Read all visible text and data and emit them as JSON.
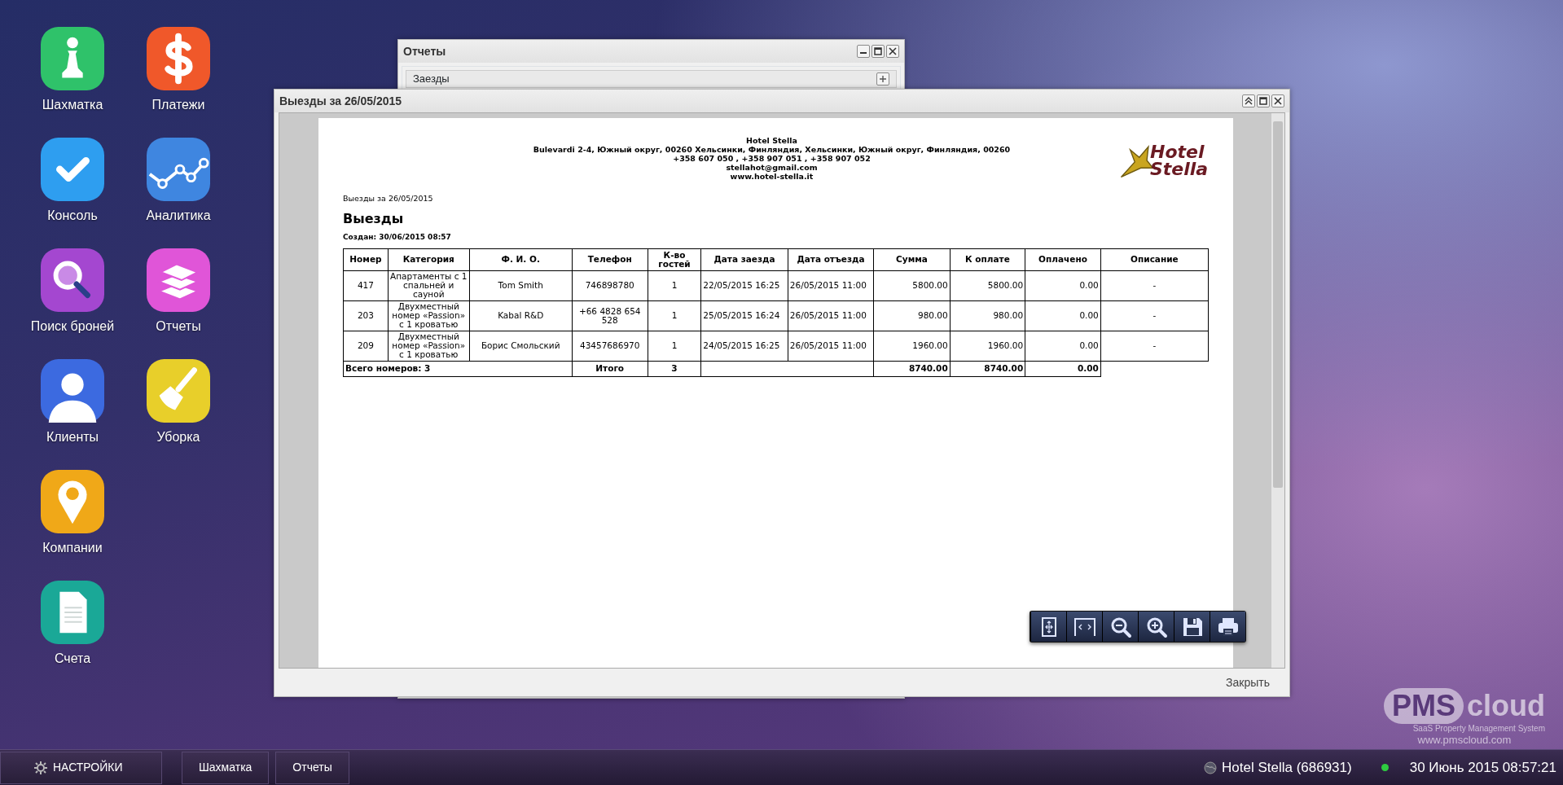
{
  "desktop_icon_rows": [
    [
      {
        "label": "Шахматка",
        "kind": "pawn"
      },
      {
        "label": "Платежи",
        "kind": "dollar"
      }
    ],
    [
      {
        "label": "Консоль",
        "kind": "check"
      },
      {
        "label": "Аналитика",
        "kind": "chart"
      }
    ],
    [
      {
        "label": "Поиск броней",
        "kind": "search"
      },
      {
        "label": "Отчеты",
        "kind": "books"
      }
    ],
    [
      {
        "label": "Клиенты",
        "kind": "person"
      },
      {
        "label": "Уборка",
        "kind": "broom"
      }
    ],
    [
      {
        "label": "Компании",
        "kind": "pin"
      }
    ],
    [
      {
        "label": "Счета",
        "kind": "document"
      }
    ]
  ],
  "background_window": {
    "title": "Отчеты",
    "rows": [
      {
        "label": "Заезды"
      }
    ]
  },
  "report_window": {
    "title": "Выезды за 26/05/2015",
    "report": {
      "hotel_name": "Hotel Stella",
      "address": "Bulevardi 2-4, Южный округ, 00260 Хельсинки, Финляндия, Хельсинки, Южный округ, Финляндия, 00260",
      "phones": "+358 607 050 , +358 907 051 , +358 907 052",
      "email": "stellahot@gmail.com",
      "website": "www.hotel-stella.it",
      "logo_lines": [
        "Hotel",
        "Stella"
      ],
      "subtitle": "Выезды за 26/05/2015",
      "heading": "Выезды",
      "created": "Создан: 30/06/2015 08:57",
      "columns": [
        "Номер",
        "Категория",
        "Ф. И. О.",
        "Телефон",
        "К-во гостей",
        "Дата заезда",
        "Дата отъезда",
        "Сумма",
        "К оплате",
        "Оплачено",
        "Описание"
      ],
      "rows": [
        [
          "417",
          "Апартаменты с 1 спальней и сауной",
          "Tom Smith",
          "746898780",
          "1",
          "22/05/2015 16:25",
          "26/05/2015 11:00",
          "5800.00",
          "5800.00",
          "0.00",
          "-"
        ],
        [
          "203",
          "Двухместный номер «Passion» с 1 кроватью",
          "Kabal R&D",
          "+66 4828 654 528",
          "1",
          "25/05/2015 16:24",
          "26/05/2015 11:00",
          "980.00",
          "980.00",
          "0.00",
          "-"
        ],
        [
          "209",
          "Двухместный номер «Passion» с 1 кроватью",
          "Борис Смольский",
          "43457686970",
          "1",
          "24/05/2015 16:25",
          "26/05/2015 11:00",
          "1960.00",
          "1960.00",
          "0.00",
          "-"
        ]
      ],
      "totals": {
        "rooms": "Всего номеров: 3",
        "label": "Итого",
        "guests": "3",
        "sum": "8740.00",
        "to_pay": "8740.00",
        "paid": "0.00"
      }
    },
    "toolbar": [
      {
        "kind": "fit-page"
      },
      {
        "kind": "fit-width"
      },
      {
        "kind": "zoom-out"
      },
      {
        "kind": "zoom-in"
      },
      {
        "kind": "save"
      },
      {
        "kind": "print"
      }
    ],
    "footer_button": "Закрыть"
  },
  "wallpaper_logo": {
    "brand": "PMS",
    "brand_suffix": "cloud",
    "tagline": "SaaS Property Management System",
    "url": "www.pmscloud.com"
  },
  "taskbar": {
    "settings_button": "НАСТРОЙКИ",
    "tasks": [
      {
        "label": "Шахматка"
      },
      {
        "label": "Отчеты"
      }
    ],
    "hotel": "Hotel Stella (686931)",
    "online": true,
    "datetime": "30 Июнь 2015 08:57:21"
  }
}
